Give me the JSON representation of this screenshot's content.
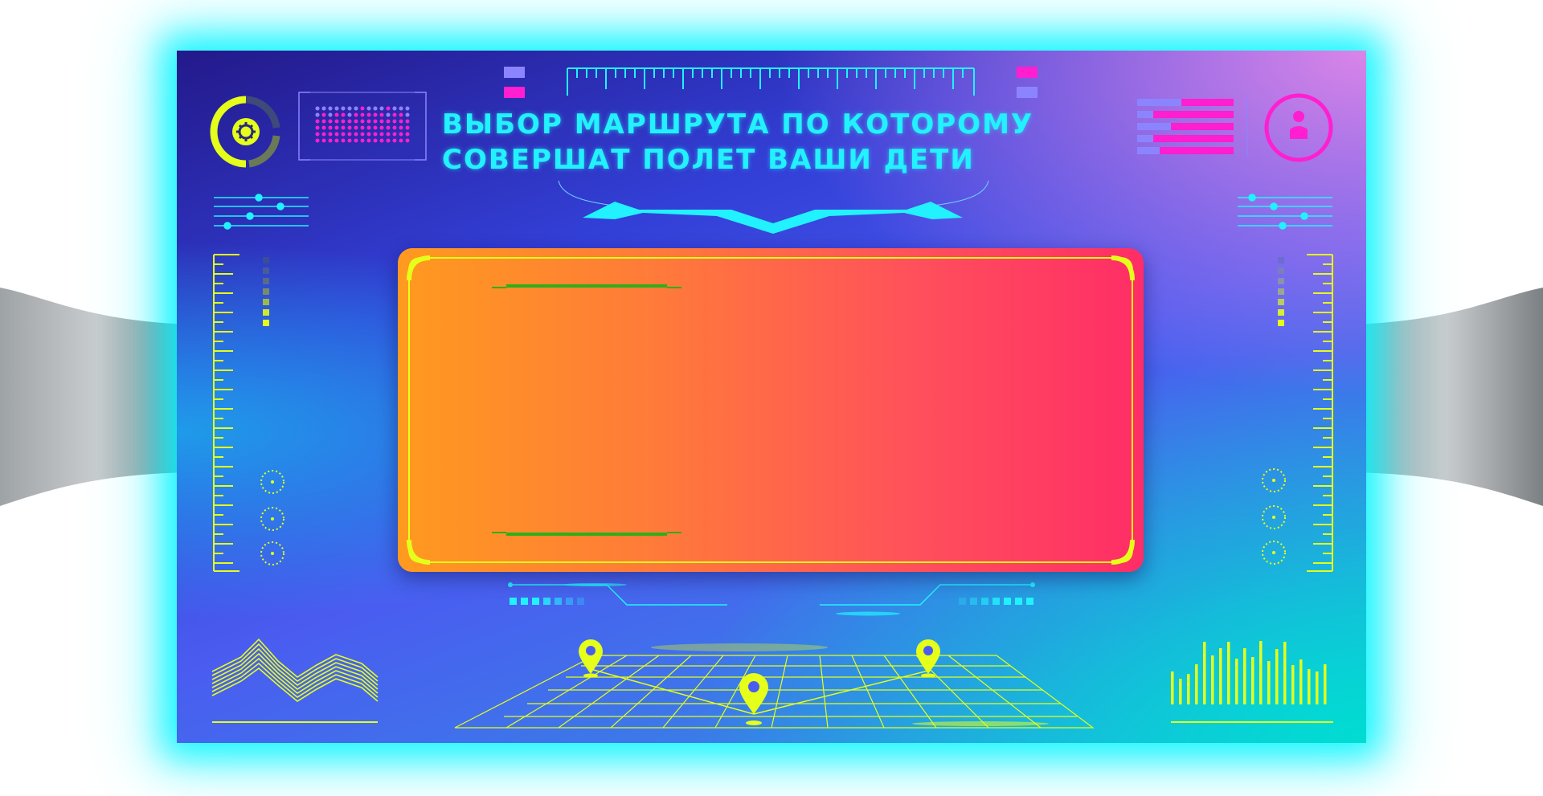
{
  "title": {
    "line1": "ВЫБОР МАРШРУТА ПО КОТОРОМУ",
    "line2": "СОВЕРШАТ ПОЛЕТ ВАШИ ДЕТИ"
  },
  "colors": {
    "accent_cyan": "#22f2ff",
    "accent_yellow": "#e5ff1a",
    "accent_magenta": "#ff1fd0",
    "accent_lavender": "#8c84ff",
    "panel_orange": "#ff9a1f",
    "panel_red": "#ff2d66",
    "panel_trim_green": "#2fae1a"
  },
  "icons": {
    "settings": "gear-icon",
    "profile": "user-icon",
    "location": "map-pin-icon"
  },
  "map_pins": 3
}
